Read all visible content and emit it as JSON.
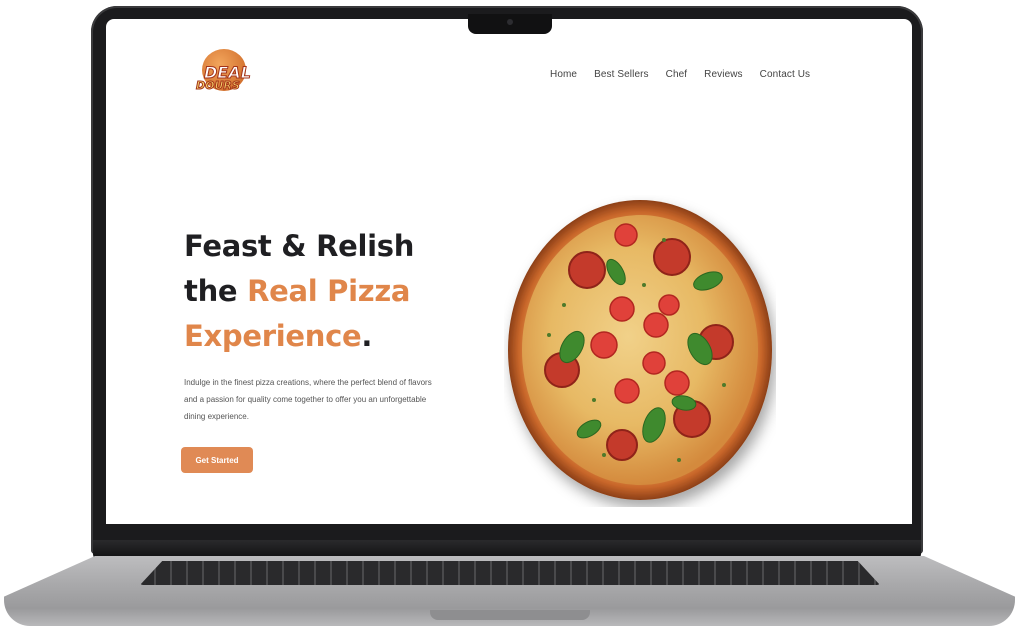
{
  "site": {
    "logo": {
      "line1": "DEAL",
      "line2": "DOURS"
    },
    "nav": [
      "Home",
      "Best Sellers",
      "Chef",
      "Reviews",
      "Contact Us"
    ],
    "hero": {
      "title_part1": "Feast & Relish",
      "title_part2": "the ",
      "title_accent": "Real Pizza",
      "title_accent2": "Experience",
      "title_end": ".",
      "description": "Indulge in the finest pizza creations, where the perfect blend of flavors and a passion for quality come together to offer you an unforgettable dining experience.",
      "cta_label": "Get Started"
    },
    "colors": {
      "accent": "#e0864a",
      "button": "#e08a55",
      "heading": "#1f1f22"
    },
    "image": {
      "icon": "pizza-image"
    }
  }
}
